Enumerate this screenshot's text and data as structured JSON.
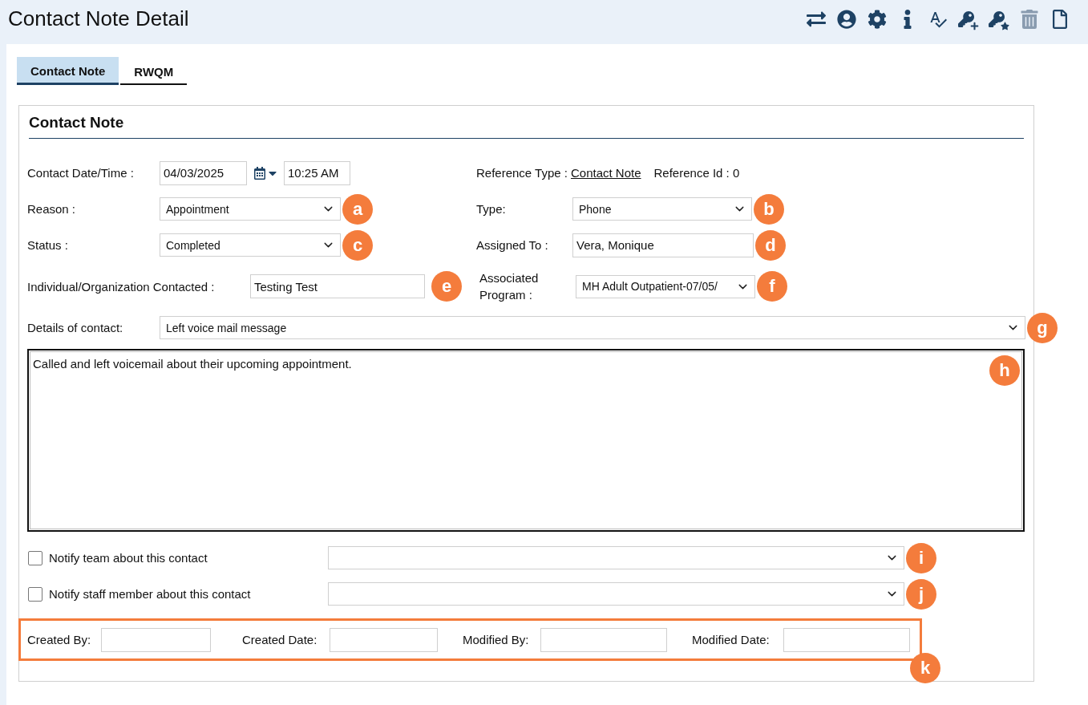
{
  "header": {
    "title": "Contact Note Detail",
    "toolbar": [
      {
        "kind": "swap",
        "disabled": false
      },
      {
        "kind": "user",
        "disabled": false
      },
      {
        "kind": "settings",
        "disabled": false
      },
      {
        "kind": "info",
        "disabled": false
      },
      {
        "kind": "spellcheck",
        "disabled": false
      },
      {
        "kind": "key-add",
        "disabled": false
      },
      {
        "kind": "key-star",
        "disabled": false
      },
      {
        "kind": "delete",
        "disabled": true
      },
      {
        "kind": "document",
        "disabled": false
      }
    ]
  },
  "tabs": [
    {
      "label": "Contact Note",
      "selected": true
    },
    {
      "label": "RWQM",
      "selected": false
    }
  ],
  "section": {
    "title": "Contact Note",
    "contact_datetime": {
      "label": "Contact Date/Time :",
      "date": "04/03/2025",
      "time": "10:25 AM"
    },
    "reference": {
      "type_label": "Reference Type :",
      "type_link": "Contact Note",
      "id_label": "Reference Id : 0"
    },
    "reason": {
      "label": "Reason :",
      "value": "Appointment",
      "marker": "a"
    },
    "type": {
      "label": "Type:",
      "value": "Phone",
      "marker": "b"
    },
    "status": {
      "label": "Status :",
      "value": "Completed",
      "marker": "c"
    },
    "assigned_to": {
      "label": "Assigned To :",
      "value": "Vera, Monique",
      "marker": "d"
    },
    "contacted": {
      "label": "Individual/Organization Contacted :",
      "value": "Testing Test",
      "marker": "e"
    },
    "program": {
      "label": "Associated Program :",
      "value": "MH Adult Outpatient-07/05/",
      "marker": "f"
    },
    "details": {
      "label": "Details of contact:",
      "value": "Left voice mail message",
      "marker": "g"
    },
    "note": {
      "value": "Called and left voicemail about their upcoming appointment.",
      "marker": "h"
    },
    "notify": [
      {
        "label": "Notify team about this contact",
        "checked": false,
        "marker": "i"
      },
      {
        "label": "Notify staff member about this contact",
        "checked": false,
        "marker": "j"
      }
    ],
    "audit": {
      "fields": [
        {
          "label": "Created By:"
        },
        {
          "label": "Created Date:"
        },
        {
          "label": "Modified By:"
        },
        {
          "label": "Modified Date:"
        }
      ],
      "marker": "k"
    }
  }
}
